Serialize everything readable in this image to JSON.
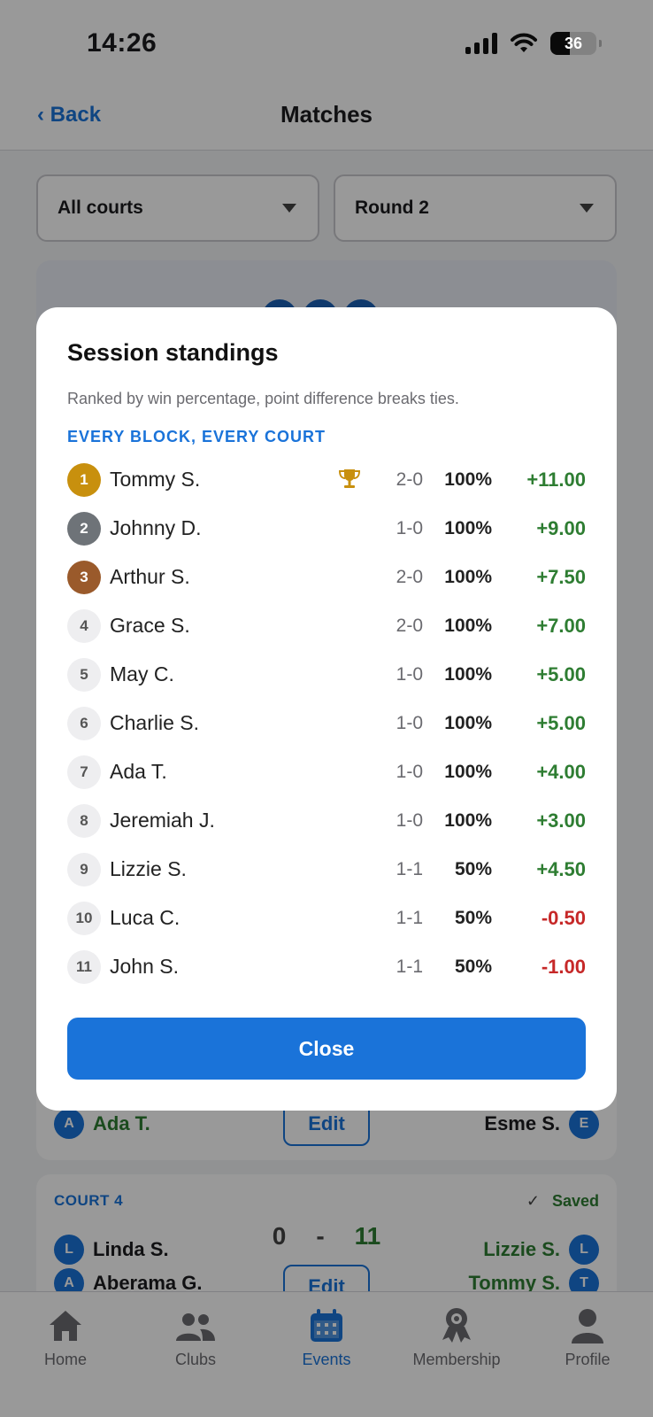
{
  "status": {
    "time": "14:26",
    "battery": "36"
  },
  "nav": {
    "back": "‹ Back",
    "title": "Matches"
  },
  "filters": {
    "court": "All courts",
    "round": "Round 2"
  },
  "court3": {
    "left_avatar": "A",
    "left_player": "Ada T.",
    "edit": "Edit",
    "right_player": "Esme S.",
    "right_avatar": "E"
  },
  "court4": {
    "label": "COURT 4",
    "saved": "Saved",
    "score_left": "0",
    "score_sep": "-",
    "score_right": "11",
    "left": [
      {
        "avatar": "L",
        "name": "Linda S."
      },
      {
        "avatar": "A",
        "name": "Aberama G."
      }
    ],
    "right": [
      {
        "avatar": "L",
        "name": "Lizzie S."
      },
      {
        "avatar": "T",
        "name": "Tommy S."
      }
    ],
    "edit": "Edit"
  },
  "tabs": [
    {
      "label": "Home",
      "icon": "home-icon"
    },
    {
      "label": "Clubs",
      "icon": "users-icon"
    },
    {
      "label": "Events",
      "icon": "calendar-icon",
      "active": true
    },
    {
      "label": "Membership",
      "icon": "badge-icon"
    },
    {
      "label": "Profile",
      "icon": "person-icon"
    }
  ],
  "modal": {
    "title": "Session standings",
    "subtitle": "Ranked by win percentage, point difference breaks ties.",
    "section": "EVERY BLOCK, EVERY COURT",
    "close": "Close",
    "rows": [
      {
        "rank": "1",
        "name": "Tommy S.",
        "trophy": true,
        "record": "2-0",
        "pct": "100%",
        "diff": "+11.00"
      },
      {
        "rank": "2",
        "name": "Johnny D.",
        "record": "1-0",
        "pct": "100%",
        "diff": "+9.00"
      },
      {
        "rank": "3",
        "name": "Arthur S.",
        "record": "2-0",
        "pct": "100%",
        "diff": "+7.50"
      },
      {
        "rank": "4",
        "name": "Grace S.",
        "record": "2-0",
        "pct": "100%",
        "diff": "+7.00"
      },
      {
        "rank": "5",
        "name": "May C.",
        "record": "1-0",
        "pct": "100%",
        "diff": "+5.00"
      },
      {
        "rank": "6",
        "name": "Charlie S.",
        "record": "1-0",
        "pct": "100%",
        "diff": "+5.00"
      },
      {
        "rank": "7",
        "name": "Ada T.",
        "record": "1-0",
        "pct": "100%",
        "diff": "+4.00"
      },
      {
        "rank": "8",
        "name": "Jeremiah J.",
        "record": "1-0",
        "pct": "100%",
        "diff": "+3.00"
      },
      {
        "rank": "9",
        "name": "Lizzie S.",
        "record": "1-1",
        "pct": "50%",
        "diff": "+4.50"
      },
      {
        "rank": "10",
        "name": "Luca C.",
        "record": "1-1",
        "pct": "50%",
        "diff": "-0.50"
      },
      {
        "rank": "11",
        "name": "John S.",
        "record": "1-1",
        "pct": "50%",
        "diff": "-1.00"
      }
    ]
  },
  "colors": {
    "accent": "#1a73d9",
    "positive": "#2e7d32",
    "negative": "#c62828",
    "gold": "#c8900e",
    "silver": "#6e7378",
    "bronze": "#9a5a2b"
  }
}
